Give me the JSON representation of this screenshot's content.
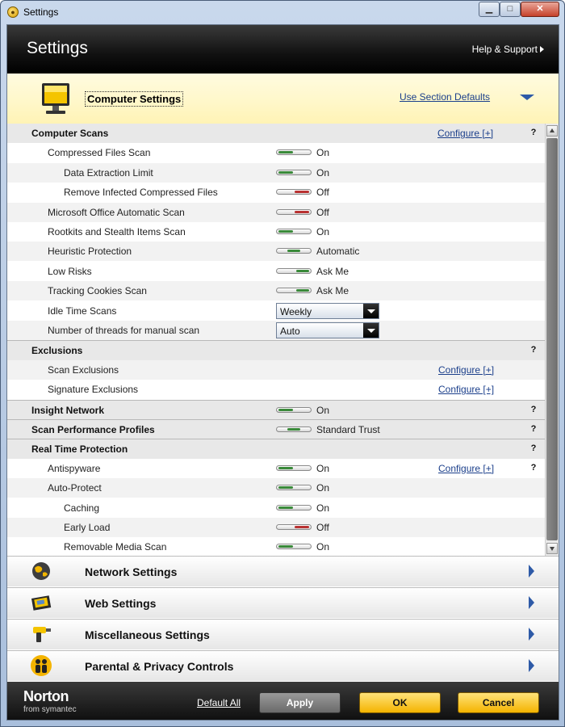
{
  "window": {
    "title": "Settings"
  },
  "header": {
    "title": "Settings",
    "help_label": "Help & Support"
  },
  "section": {
    "title": "Computer Settings",
    "use_defaults": "Use Section Defaults"
  },
  "help_glyph": "?",
  "rows": [
    {
      "label": "Computer Scans",
      "indent": 0,
      "kind": "group",
      "configure": "Configure [+]",
      "help": true
    },
    {
      "label": "Compressed Files Scan",
      "indent": 1,
      "control": "toggle",
      "state": "on",
      "value": "On"
    },
    {
      "label": "Data Extraction Limit",
      "indent": 2,
      "control": "toggle",
      "state": "on",
      "value": "On"
    },
    {
      "label": "Remove Infected Compressed Files",
      "indent": 2,
      "control": "toggle",
      "state": "off",
      "value": "Off"
    },
    {
      "label": "Microsoft Office Automatic Scan",
      "indent": 1,
      "control": "toggle",
      "state": "off",
      "value": "Off"
    },
    {
      "label": "Rootkits and Stealth Items Scan",
      "indent": 1,
      "control": "toggle",
      "state": "on",
      "value": "On"
    },
    {
      "label": "Heuristic Protection",
      "indent": 1,
      "control": "toggle",
      "state": "mid",
      "value": "Automatic"
    },
    {
      "label": "Low Risks",
      "indent": 1,
      "control": "toggle",
      "state": "right",
      "value": "Ask Me"
    },
    {
      "label": "Tracking Cookies Scan",
      "indent": 1,
      "control": "toggle",
      "state": "right",
      "value": "Ask Me"
    },
    {
      "label": "Idle Time Scans",
      "indent": 1,
      "control": "dropdown",
      "value": "Weekly"
    },
    {
      "label": "Number of threads for manual scan",
      "indent": 1,
      "control": "dropdown",
      "value": "Auto"
    },
    {
      "label": "Exclusions",
      "indent": 0,
      "kind": "group",
      "help": true,
      "divider": true
    },
    {
      "label": "Scan Exclusions",
      "indent": 1,
      "configure": "Configure [+]"
    },
    {
      "label": "Signature Exclusions",
      "indent": 1,
      "configure": "Configure [+]"
    },
    {
      "label": "Insight Network",
      "indent": 0,
      "kind": "group",
      "control": "toggle",
      "state": "on",
      "value": "On",
      "help": true,
      "divider": true
    },
    {
      "label": "Scan Performance Profiles",
      "indent": 0,
      "kind": "group",
      "control": "toggle",
      "state": "mid",
      "value": "Standard Trust",
      "help": true,
      "divider": true
    },
    {
      "label": "Real Time Protection",
      "indent": 0,
      "kind": "group",
      "help": true,
      "divider": true
    },
    {
      "label": "Antispyware",
      "indent": 1,
      "control": "toggle",
      "state": "on",
      "value": "On",
      "configure": "Configure [+]",
      "help": true
    },
    {
      "label": "Auto-Protect",
      "indent": 1,
      "control": "toggle",
      "state": "on",
      "value": "On"
    },
    {
      "label": "Caching",
      "indent": 2,
      "control": "toggle",
      "state": "on",
      "value": "On"
    },
    {
      "label": "Early Load",
      "indent": 2,
      "control": "toggle",
      "state": "off",
      "value": "Off"
    },
    {
      "label": "Removable Media Scan",
      "indent": 2,
      "control": "toggle",
      "state": "on",
      "value": "On"
    }
  ],
  "categories": [
    {
      "label": "Network Settings",
      "icon": "globe-icon"
    },
    {
      "label": "Web Settings",
      "icon": "web-icon"
    },
    {
      "label": "Miscellaneous Settings",
      "icon": "tools-icon"
    },
    {
      "label": "Parental & Privacy Controls",
      "icon": "family-icon"
    }
  ],
  "footer": {
    "logo_name": "Norton",
    "logo_sub": "from symantec",
    "default_all": "Default All",
    "apply": "Apply",
    "ok": "OK",
    "cancel": "Cancel"
  },
  "colors": {
    "toggle_on": "#3a8a3a",
    "toggle_off": "#b93232",
    "link": "#1b3f8b",
    "accent": "#f4b400"
  }
}
